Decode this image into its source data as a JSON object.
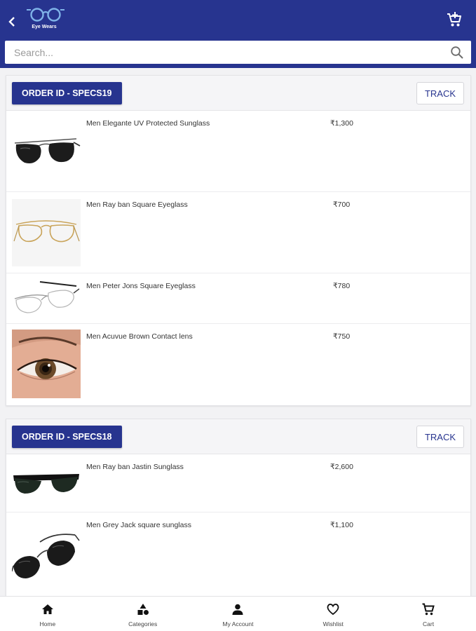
{
  "header": {
    "logo_text": "Eye Wears",
    "search_placeholder": "Search...",
    "accent": "#27348f"
  },
  "orders": [
    {
      "order_id": "ORDER ID - SPECS19",
      "track_label": "TRACK",
      "items": [
        {
          "name": "Men Elegante UV Protected Sunglass",
          "price": "₹1,300",
          "image": "aviator-sunglass"
        },
        {
          "name": "Men Ray ban Square Eyeglass",
          "price": "₹700",
          "image": "gold-aviator-eyeglass"
        },
        {
          "name": "Men Peter Jons Square Eyeglass",
          "price": "₹780",
          "image": "rimless-eyeglass"
        },
        {
          "name": "Men Acuvue Brown Contact lens",
          "price": "₹750",
          "image": "brown-eye-contact-lens"
        }
      ]
    },
    {
      "order_id": "ORDER ID - SPECS18",
      "track_label": "TRACK",
      "items": [
        {
          "name": "Men Ray ban Jastin Sunglass",
          "price": "₹2,600",
          "image": "wayfarer-sunglass"
        },
        {
          "name": "Men Grey Jack square sunglass",
          "price": "₹1,100",
          "image": "black-aviator-sunglass"
        }
      ]
    }
  ],
  "bottom_nav": [
    {
      "label": "Home",
      "icon": "home-icon"
    },
    {
      "label": "Categories",
      "icon": "categories-icon"
    },
    {
      "label": "My Account",
      "icon": "account-icon"
    },
    {
      "label": "Wishlist",
      "icon": "heart-icon"
    },
    {
      "label": "Cart",
      "icon": "cart-icon"
    }
  ]
}
